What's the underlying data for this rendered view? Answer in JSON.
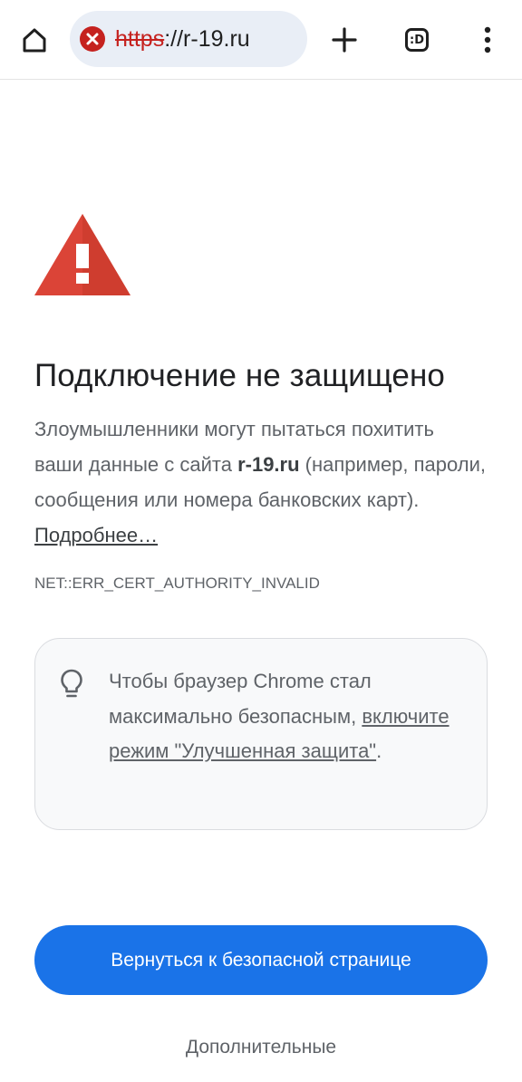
{
  "toolbar": {
    "home_icon": "home-icon",
    "security_icon": "not-secure-icon",
    "url_scheme": "https",
    "url_rest": "://r-19.ru",
    "new_tab_icon": "plus-icon",
    "tab_switcher_label": ":D",
    "menu_icon": "more-vert-icon"
  },
  "interstitial": {
    "warning_icon": "warning-triangle-icon",
    "warning_color": "#db4437",
    "heading": "Подключение не защищено",
    "desc_part1": "Злоумышленники могут пытаться похитить ваши данные с сайта ",
    "desc_host": "r-19.ru",
    "desc_part2": " (например, пароли, сообщения или номера банковских карт). ",
    "learn_more": "Подробнее…",
    "error_code": "NET::ERR_CERT_AUTHORITY_INVALID"
  },
  "tip": {
    "icon": "lightbulb-icon",
    "text_part1": "Чтобы браузер Chrome стал максимально безопасным, ",
    "link_text": "включите режим \"Улучшенная защита\"",
    "text_part2": "."
  },
  "actions": {
    "primary_label": "Вернуться к безопасной странице",
    "primary_color": "#1a73e8",
    "secondary_label": "Дополнительные"
  }
}
